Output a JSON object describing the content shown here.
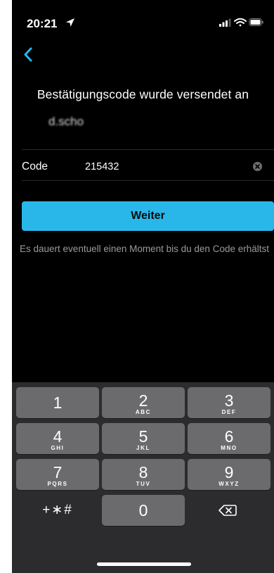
{
  "status_bar": {
    "time": "20:21"
  },
  "title": "Bestätigungscode wurde versendet an",
  "recipient": "d.scho",
  "code": {
    "label": "Code",
    "value": "215432"
  },
  "continue_button": {
    "label": "Weiter"
  },
  "hint": "Es dauert eventuell einen Moment bis du den Code erhältst",
  "keyboard": {
    "keys": [
      {
        "digit": "1",
        "letters": ""
      },
      {
        "digit": "2",
        "letters": "ABC"
      },
      {
        "digit": "3",
        "letters": "DEF"
      },
      {
        "digit": "4",
        "letters": "GHI"
      },
      {
        "digit": "5",
        "letters": "JKL"
      },
      {
        "digit": "6",
        "letters": "MNO"
      },
      {
        "digit": "7",
        "letters": "PQRS"
      },
      {
        "digit": "8",
        "letters": "TUV"
      },
      {
        "digit": "9",
        "letters": "WXYZ"
      }
    ],
    "symbols_label": "+∗#",
    "zero": "0"
  },
  "colors": {
    "accent": "#29b7ea",
    "background": "#000000",
    "keyboard": "#2c2c2e",
    "key": "#6b6b6d"
  }
}
